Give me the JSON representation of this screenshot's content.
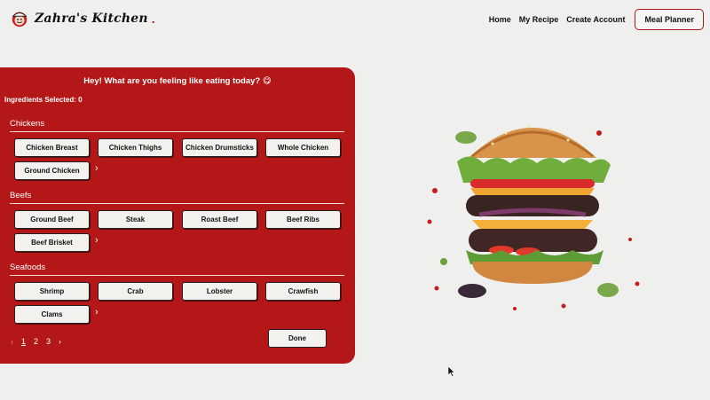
{
  "header": {
    "logo_text": "Zahra's Kitchen",
    "logo_dot": ".",
    "nav": [
      "Home",
      "My Recipe",
      "Create Account"
    ],
    "cta": "Meal Planner"
  },
  "panel": {
    "greeting": "Hey! What are you feeling like eating today? 😋",
    "selected": "Ingredients Selected: 0",
    "sections": [
      {
        "title": "Chickens",
        "items": [
          "Chicken Breast",
          "Chicken Thighs",
          "Chicken Drumsticks",
          "Whole Chicken",
          "Ground Chicken"
        ]
      },
      {
        "title": "Beefs",
        "items": [
          "Ground Beef",
          "Steak",
          "Roast Beef",
          "Beef Ribs",
          "Beef Brisket"
        ]
      },
      {
        "title": "Seafoods",
        "items": [
          "Shrimp",
          "Crab",
          "Lobster",
          "Crawfish",
          "Clams"
        ]
      }
    ],
    "more_icon": "›",
    "pagination": {
      "prev": "‹",
      "pages": [
        "1",
        "2",
        "3"
      ],
      "next": "›"
    },
    "done": "Done"
  },
  "colors": {
    "brand": "#b31717",
    "background": "#efefee"
  },
  "icons": [
    "chef-logo-icon",
    "chevron-right-icon",
    "chevron-left-icon",
    "burger-image",
    "mouse-cursor-icon"
  ]
}
